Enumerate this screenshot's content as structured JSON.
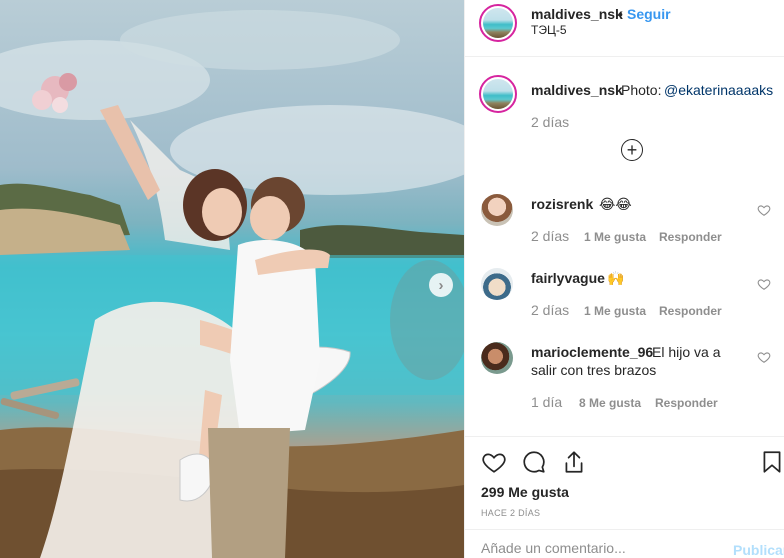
{
  "post": {
    "author": "maldives_nsk",
    "separator": "•",
    "follow_label": "Seguir",
    "location": "ТЭЦ-5"
  },
  "caption": {
    "username": "maldives_nsk",
    "text": "Photo:",
    "mention": "@ekaterinaaaaks",
    "time": "2 días",
    "load_more_icon": "plus-circle-icon"
  },
  "comments": [
    {
      "username": "rozisrenk",
      "text": "😂😂",
      "time": "2 días",
      "likes": "1 Me gusta",
      "reply": "Responder"
    },
    {
      "username": "fairlyvague",
      "text": "🙌",
      "time": "2 días",
      "likes": "1 Me gusta",
      "reply": "Responder"
    },
    {
      "username": "marioclemente_96",
      "text_line1": "El hijo va a",
      "text_line2": "salir con tres brazos",
      "time": "1 día",
      "likes": "8 Me gusta",
      "reply": "Responder"
    }
  ],
  "actions": {
    "icons": [
      "heart-icon",
      "comment-icon",
      "share-icon",
      "bookmark-icon"
    ],
    "likes": "299 Me gusta",
    "timestamp": "HACE 2 DÍAS"
  },
  "comment_box": {
    "placeholder": "Añade un comentario...",
    "publish_label": "Publicar"
  },
  "photo": {
    "next_icon": "chevron-right-icon",
    "next_glyph": "›"
  },
  "colors": {
    "link": "#3897f0",
    "mention": "#003569",
    "ring": "#d6249f",
    "muted": "#8e8e8e"
  }
}
